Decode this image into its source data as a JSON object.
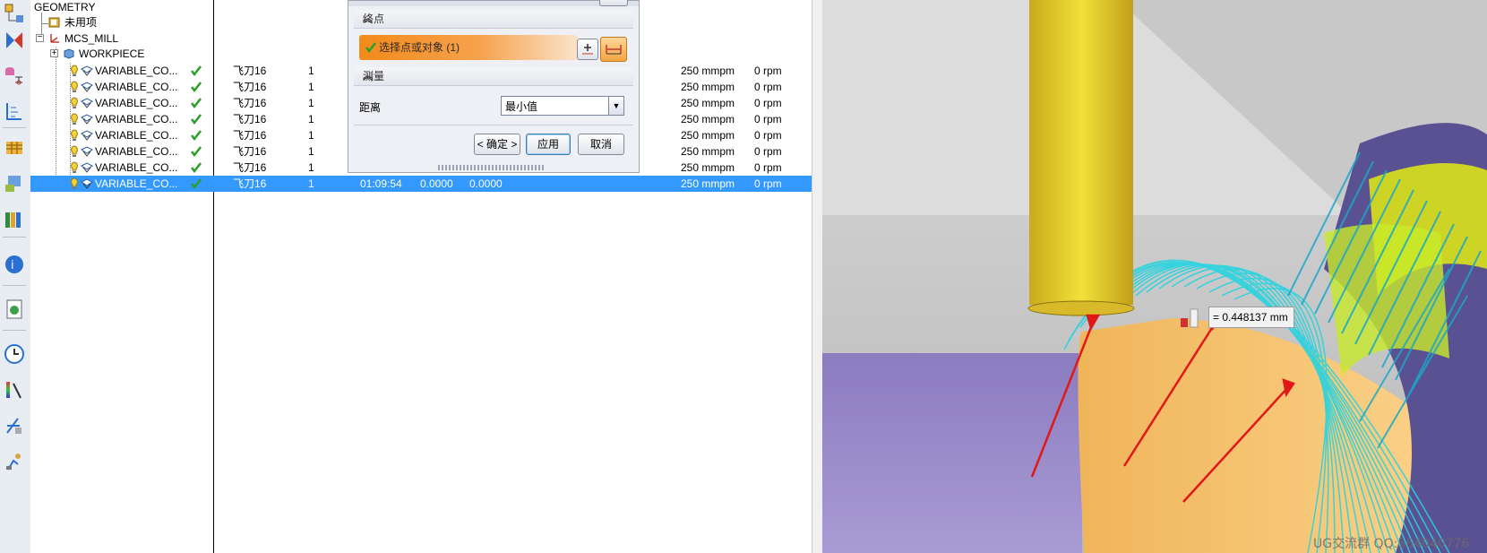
{
  "navigator": {
    "rows": [
      {
        "name": "GEOMETRY"
      },
      {
        "name": "未用项"
      },
      {
        "name": "MCS_MILL"
      },
      {
        "name": "WORKPIECE"
      }
    ],
    "ops": [
      {
        "name": "VARIABLE_CO...",
        "tool": "飞刀16",
        "path": "1",
        "time": "",
        "c1": "",
        "c2": "",
        "feed": "250 mmpm",
        "speed": "0 rpm"
      },
      {
        "name": "VARIABLE_CO...",
        "tool": "飞刀16",
        "path": "1",
        "time": "",
        "c1": "",
        "c2": "",
        "feed": "250 mmpm",
        "speed": "0 rpm"
      },
      {
        "name": "VARIABLE_CO...",
        "tool": "飞刀16",
        "path": "1",
        "time": "",
        "c1": "",
        "c2": "",
        "feed": "250 mmpm",
        "speed": "0 rpm"
      },
      {
        "name": "VARIABLE_CO...",
        "tool": "飞刀16",
        "path": "1",
        "time": "",
        "c1": "",
        "c2": "",
        "feed": "250 mmpm",
        "speed": "0 rpm"
      },
      {
        "name": "VARIABLE_CO...",
        "tool": "飞刀16",
        "path": "1",
        "time": "",
        "c1": "",
        "c2": "",
        "feed": "250 mmpm",
        "speed": "0 rpm"
      },
      {
        "name": "VARIABLE_CO...",
        "tool": "飞刀16",
        "path": "1",
        "time": "",
        "c1": "",
        "c2": "",
        "feed": "250 mmpm",
        "speed": "0 rpm"
      },
      {
        "name": "VARIABLE_CO...",
        "tool": "飞刀16",
        "path": "1",
        "time": "",
        "c1": "",
        "c2": "",
        "feed": "250 mmpm",
        "speed": "0 rpm"
      },
      {
        "name": "VARIABLE_CO...",
        "tool": "飞刀16",
        "path": "1",
        "time": "01:09:54",
        "c1": "0.0000",
        "c2": "0.0000",
        "feed": "250 mmpm",
        "speed": "0 rpm",
        "selected": true
      }
    ]
  },
  "dialog": {
    "endpoint_section": "终点",
    "select_object": "选择点或对象 (1)",
    "measure_section": "测量",
    "distance_label": "距离",
    "distance_value": "最小值",
    "ok": "< 确定 >",
    "apply": "应用",
    "cancel": "取消"
  },
  "viewport": {
    "measurement": "= 0.448137 mm",
    "watermark": "UG交流群 QQ:564040776"
  },
  "colors": {
    "selection": "#3399ff",
    "check": "#2a9d2a",
    "tool_yellow": "#e4cf3a",
    "part_purple": "#9f8fc9",
    "part_orange": "#f8c77a",
    "toolpath_cyan": "#27d3e0",
    "arrow_red": "#e01818"
  }
}
